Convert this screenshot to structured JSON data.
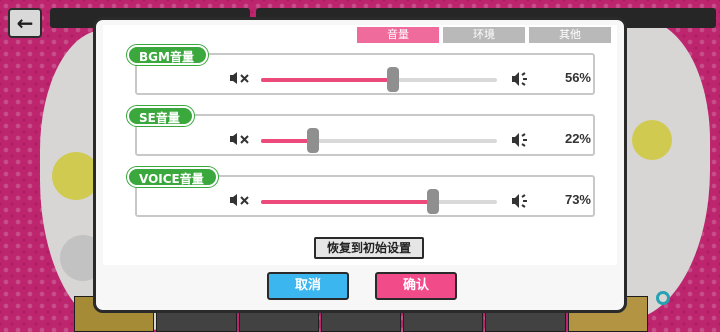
{
  "tabs": [
    {
      "label": "音量",
      "active": true
    },
    {
      "label": "环境",
      "active": false
    },
    {
      "label": "其他",
      "active": false
    }
  ],
  "volumes": [
    {
      "label": "BGM音量",
      "value_text": "56%",
      "percent": 56
    },
    {
      "label": "SE音量",
      "value_text": "22%",
      "percent": 22
    },
    {
      "label": "VOICE音量",
      "value_text": "73%",
      "percent": 73
    }
  ],
  "reset_label": "恢复到初始设置",
  "cancel_label": "取消",
  "confirm_label": "确认",
  "icons": {
    "back": "arrow-left-icon",
    "mute": "speaker-mute-icon",
    "max": "speaker-max-icon"
  },
  "colors": {
    "slider_fill": "#ec4a7b",
    "label_green": "#3aa83d",
    "tab_active": "#ef6b9b",
    "cancel": "#3bb6ee",
    "confirm": "#f24b8a"
  }
}
